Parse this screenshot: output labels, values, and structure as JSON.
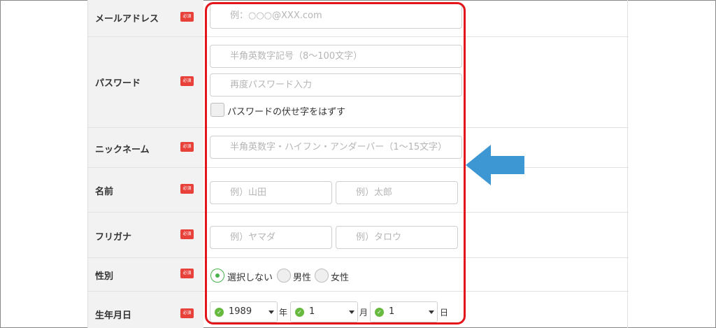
{
  "required_badge": "必須",
  "rows": {
    "email": {
      "label": "メールアドレス",
      "placeholder": "例：○○○@XXX.com"
    },
    "password": {
      "label": "パスワード",
      "placeholder": "半角英数字記号（8～100文字）",
      "confirm_placeholder": "再度パスワード入力",
      "show_password_label": "パスワードの伏せ字をはずす"
    },
    "nickname": {
      "label": "ニックネーム",
      "placeholder": "半角英数字・ハイフン・アンダーバー（1～15文字）"
    },
    "name": {
      "label": "名前",
      "last_placeholder": "例）山田",
      "first_placeholder": "例）太郎"
    },
    "furigana": {
      "label": "フリガナ",
      "last_placeholder": "例）ヤマダ",
      "first_placeholder": "例）タロウ"
    },
    "gender": {
      "label": "性別",
      "options": [
        "選択しない",
        "男性",
        "女性"
      ],
      "selected": "選択しない"
    },
    "birthdate": {
      "label": "生年月日",
      "year": "1989",
      "year_unit": "年",
      "month": "1",
      "month_unit": "月",
      "day": "1",
      "day_unit": "日"
    }
  },
  "colors": {
    "highlight_border": "#e3151a",
    "arrow": "#3d97d3",
    "required_badge": "#e8413a",
    "check_green": "#67b940"
  },
  "icons": {
    "arrow": "left-arrow-icon",
    "check": "check-circle-icon",
    "dropdown": "caret-down-icon"
  }
}
